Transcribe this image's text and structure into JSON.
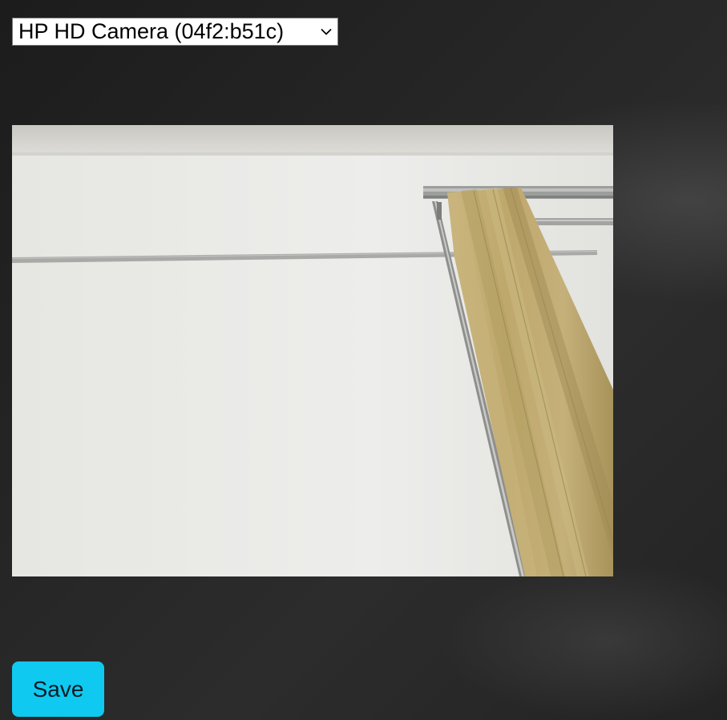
{
  "camera_select": {
    "selected": "HP HD Camera (04f2:b51c)",
    "icon": "chevron-down-icon"
  },
  "video": {
    "icon": "camera-feed"
  },
  "actions": {
    "save_label": "Save",
    "save_color": "#0fc9f0"
  }
}
